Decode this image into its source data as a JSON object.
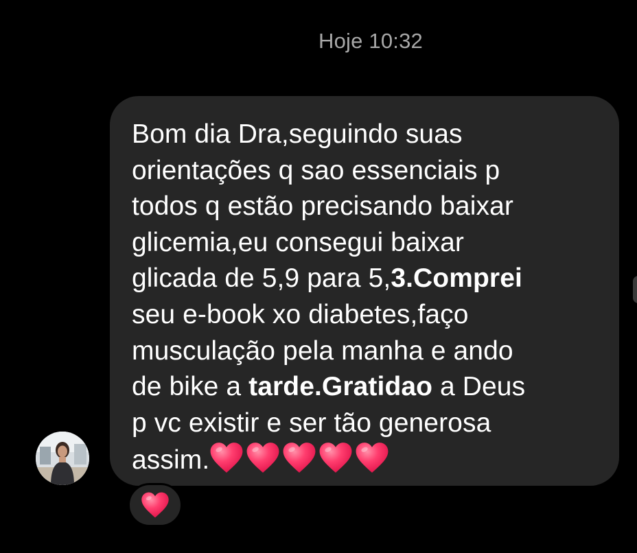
{
  "chat": {
    "timestamp": "Hoje 10:32"
  },
  "message": {
    "segments": {
      "s1": "Bom dia Dra,seguindo suas\norientações q sao essenciais p\ntodos q estão precisando baixar\nglicemia,eu consegui baixar\nglicada de 5,9 para 5,",
      "b1": "3.Comprei",
      "s2": "\nseu e-book xo diabetes,faço\nmusculação pela manha e ando\nde bike a ",
      "b2": "tarde.Gratidao",
      "s3": " a Deus\np vc existir e ser tão generosa\nassim."
    },
    "trailing_emoji": [
      "heart-icon",
      "heart-icon",
      "heart-icon",
      "heart-icon",
      "heart-icon"
    ]
  },
  "sender": {
    "avatar_icon": "profile-photo"
  },
  "reaction": {
    "emoji": "heart-icon"
  },
  "colors": {
    "background": "#000000",
    "bubble": "#262626",
    "text": "#ffffff",
    "timestamp": "#a8a8a8",
    "heart": "#ff3d6e"
  }
}
